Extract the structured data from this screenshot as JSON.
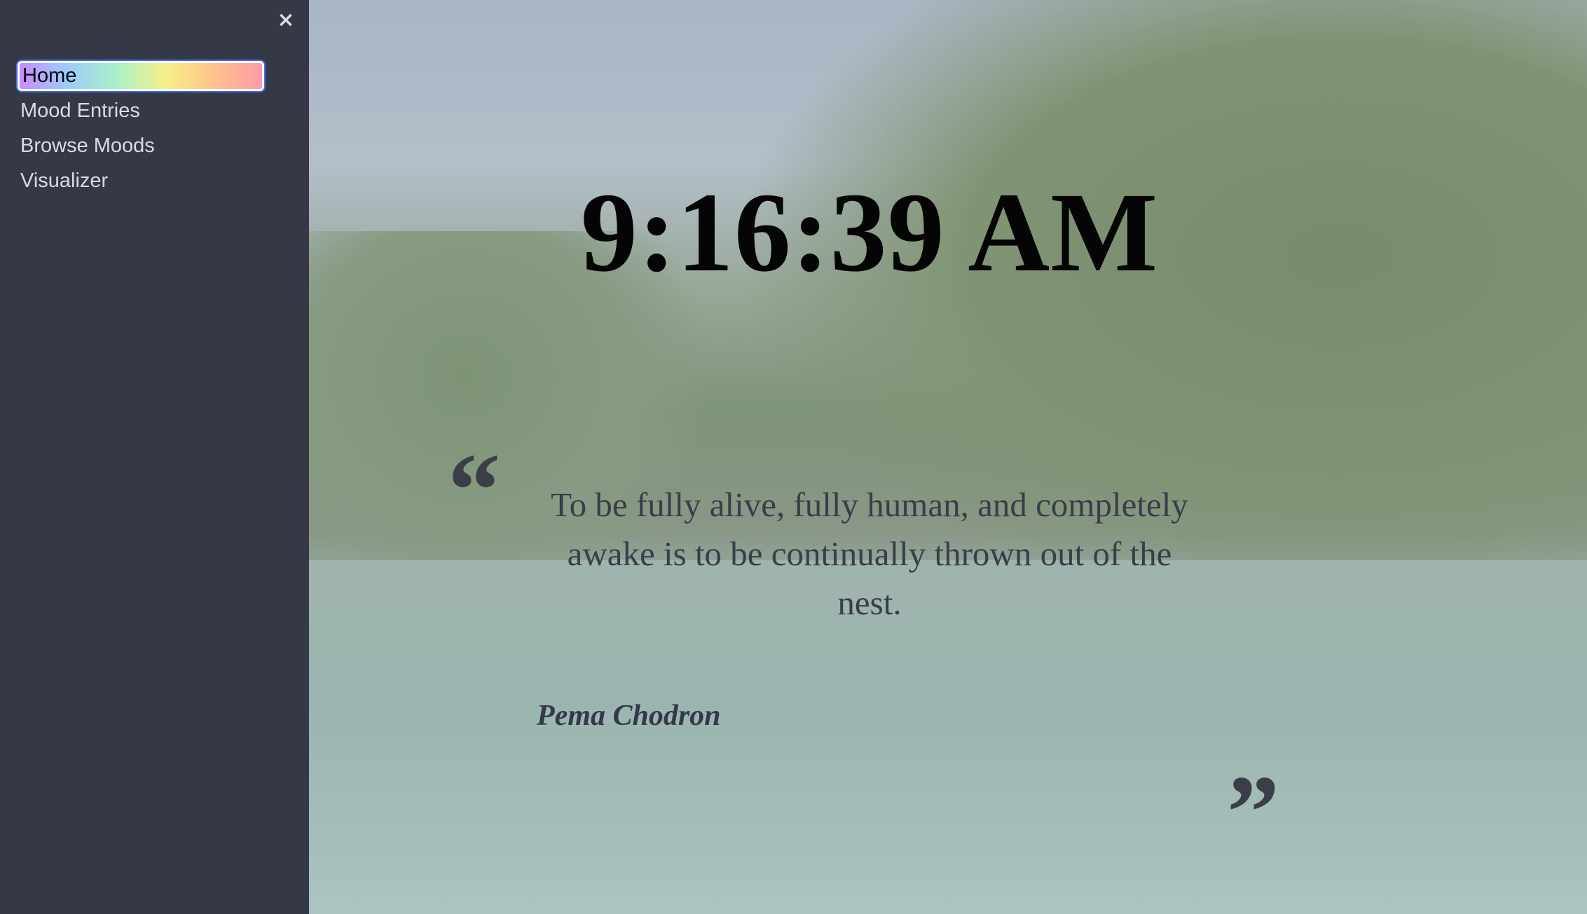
{
  "sidebar": {
    "close_icon": "×",
    "items": [
      {
        "label": "Home",
        "active": true
      },
      {
        "label": "Mood Entries"
      },
      {
        "label": "Browse Moods"
      },
      {
        "label": "Visualizer"
      }
    ]
  },
  "main": {
    "clock": "9:16:39 AM",
    "quote": {
      "open_mark": "“",
      "text": "To be fully alive, fully human, and completely awake is to be continually thrown out of the nest.",
      "author": "Pema Chodron",
      "close_mark": "”"
    }
  },
  "icons": {
    "close": "close-icon",
    "quote_open": "quote-open-icon",
    "quote_close": "quote-close-icon"
  },
  "colors": {
    "sidebar_bg": "#343847",
    "nav_text": "#d9dbe2",
    "active_focus_outline": "#3c6ee0",
    "clock_text": "#050505",
    "quote_text": "#3a3d4a"
  }
}
